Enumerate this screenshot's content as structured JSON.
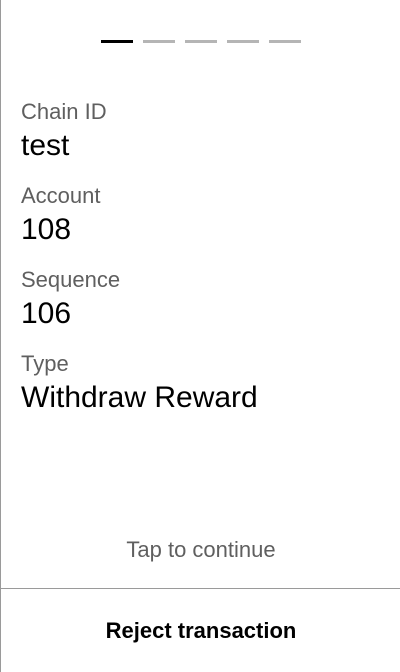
{
  "progress": {
    "total_steps": 5,
    "current_step": 1
  },
  "transaction": {
    "chain_id": {
      "label": "Chain ID",
      "value": "test"
    },
    "account": {
      "label": "Account",
      "value": "108"
    },
    "sequence": {
      "label": "Sequence",
      "value": "106"
    },
    "type": {
      "label": "Type",
      "value": "Withdraw Reward"
    }
  },
  "actions": {
    "tap_hint": "Tap to continue",
    "reject_label": "Reject transaction"
  },
  "colors": {
    "active_step": "#000000",
    "inactive_step": "#b5b5b5",
    "label_text": "#5f5f5f",
    "divider": "#9a9a9a"
  }
}
